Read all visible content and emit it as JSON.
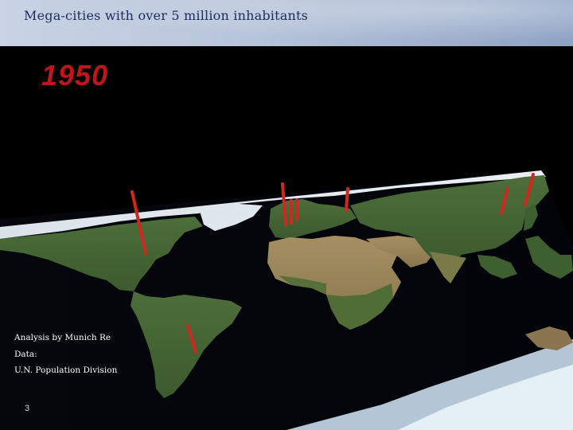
{
  "slide": {
    "title": "Mega-cities with over 5 million inhabitants",
    "year": "1950",
    "credits": {
      "line1": "Analysis by Munich Re",
      "line2": "Data:",
      "line3": "U.N. Population Division"
    },
    "page_number": "3"
  },
  "map": {
    "description_icon": "world-map-icon",
    "marker_color": "#d0281e",
    "city_markers": [
      {
        "region": "North America (east coast)"
      },
      {
        "region": "Western Europe"
      },
      {
        "region": "Western Europe"
      },
      {
        "region": "Western Europe"
      },
      {
        "region": "Eastern Europe"
      },
      {
        "region": "East Asia"
      },
      {
        "region": "East Asia"
      },
      {
        "region": "South America"
      }
    ]
  }
}
